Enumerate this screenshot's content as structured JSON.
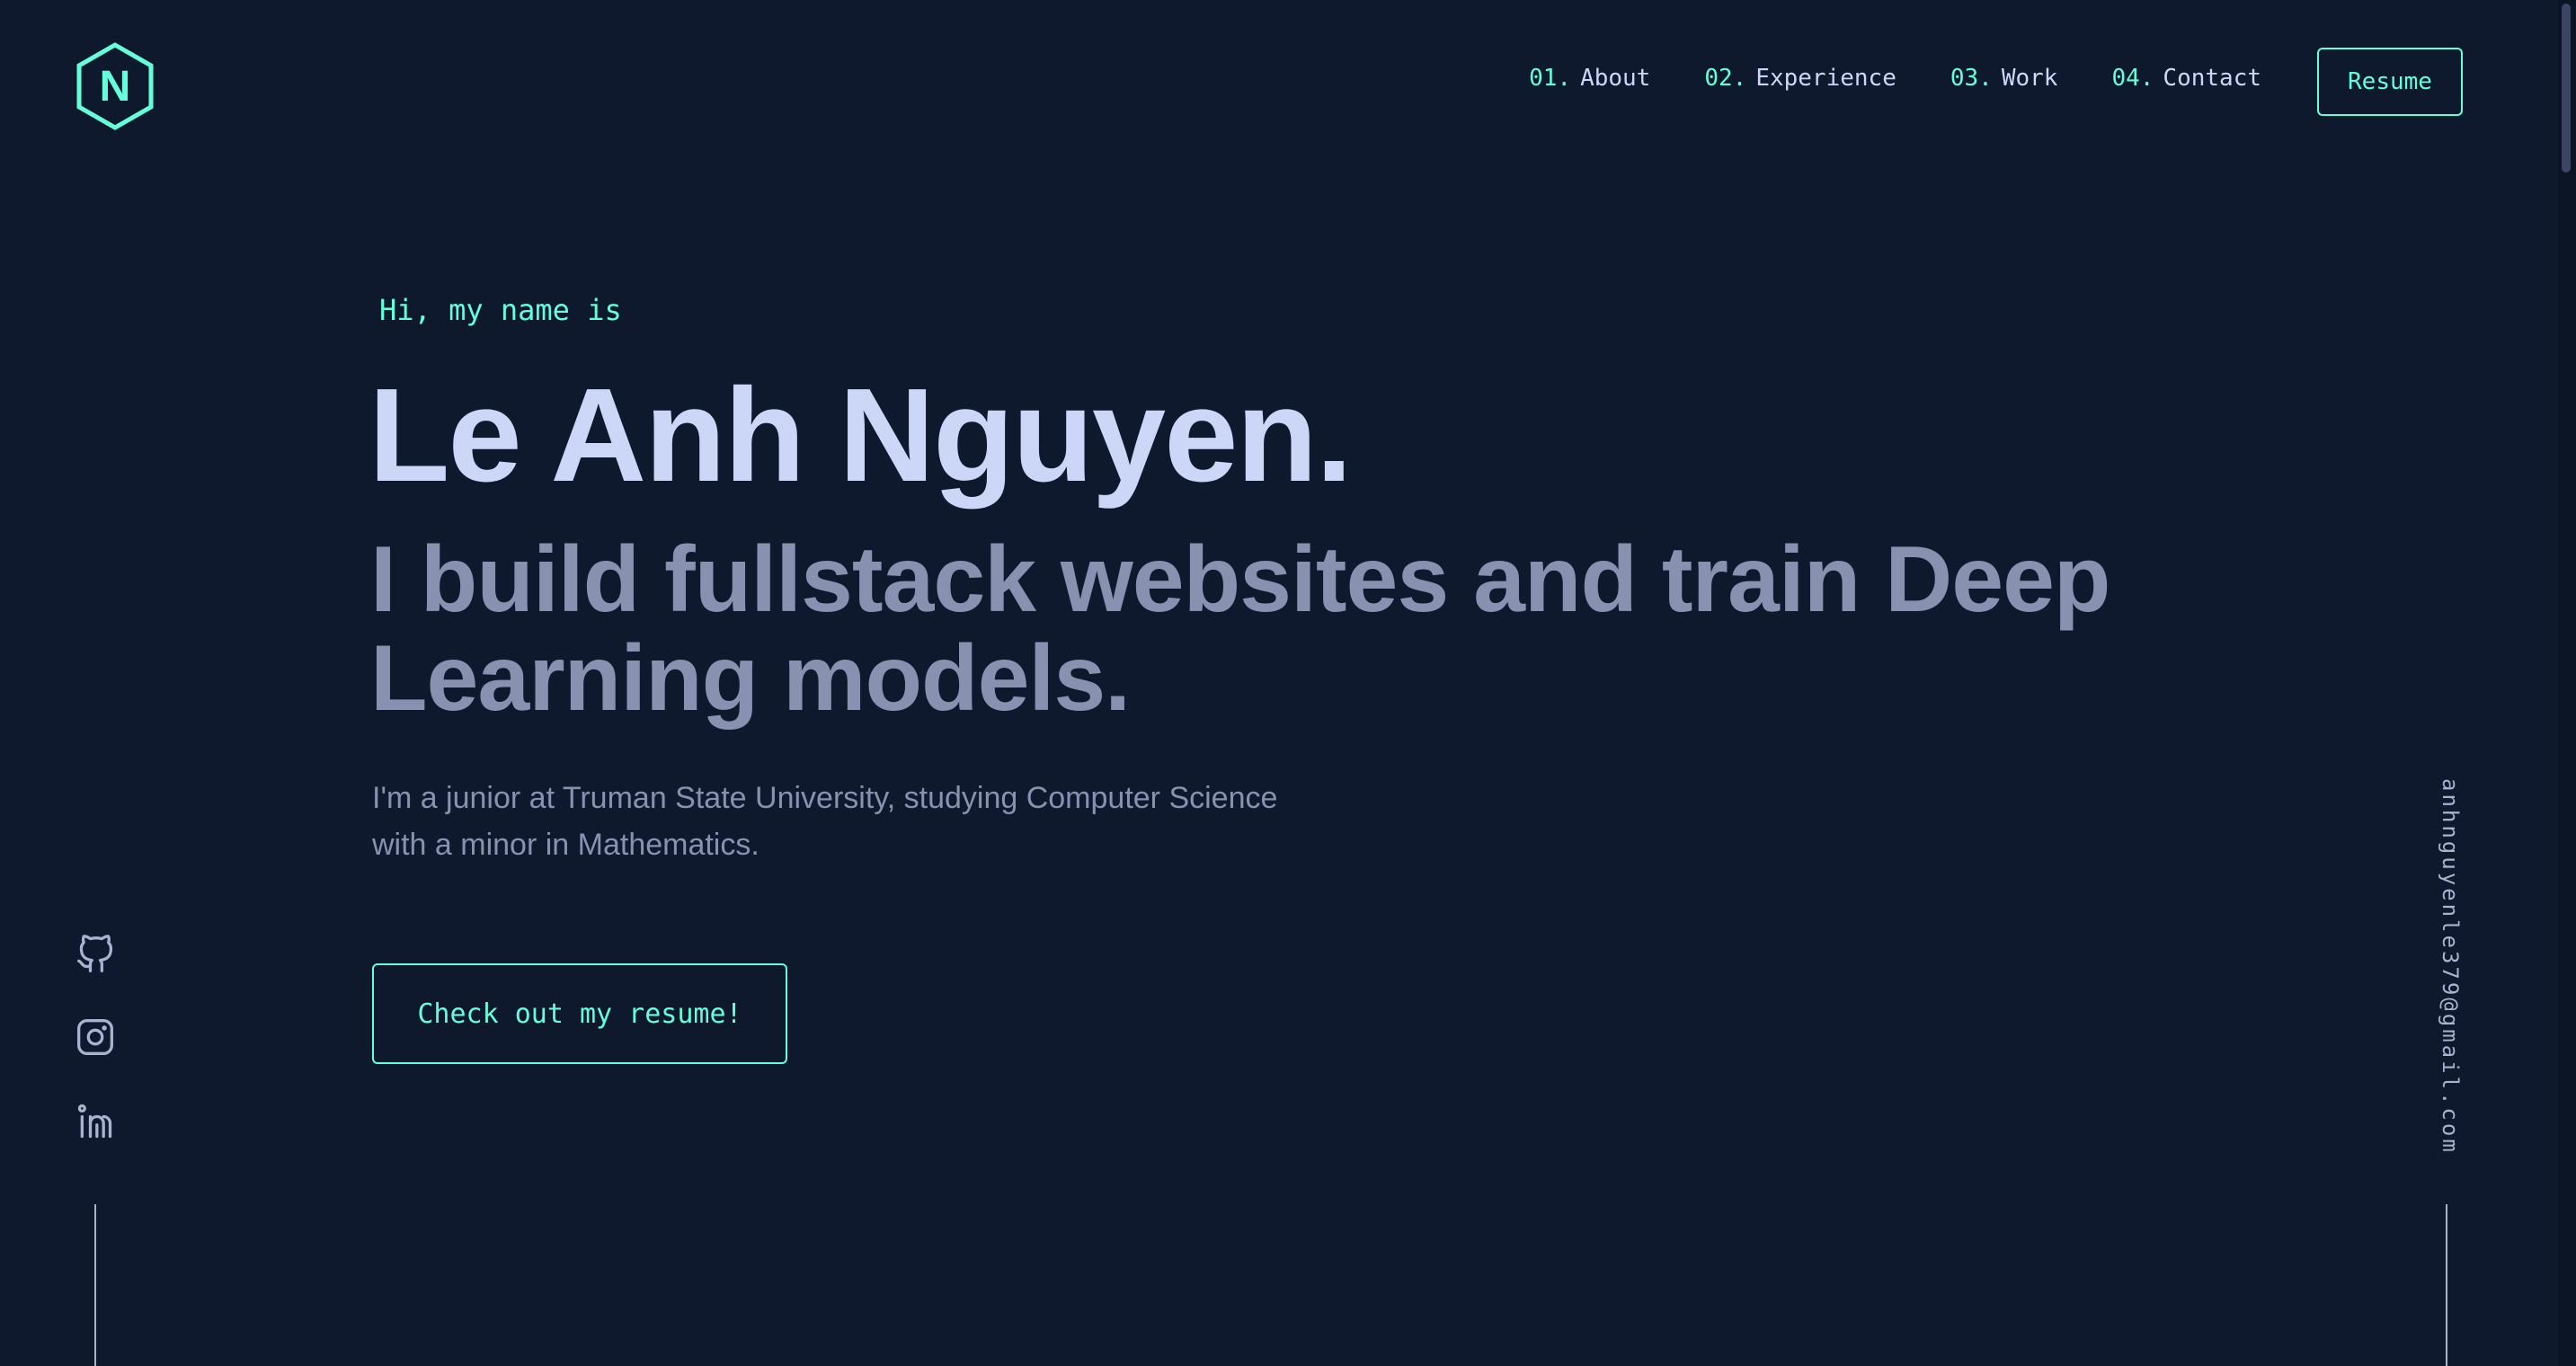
{
  "logo": {
    "letter": "N",
    "icon": "hexagon-logo-icon"
  },
  "nav": {
    "items": [
      {
        "number": "01.",
        "label": "About"
      },
      {
        "number": "02.",
        "label": "Experience"
      },
      {
        "number": "03.",
        "label": "Work"
      },
      {
        "number": "04.",
        "label": "Contact"
      }
    ],
    "resume_label": "Resume"
  },
  "hero": {
    "greeting": "Hi, my name is",
    "name": "Le Anh Nguyen.",
    "tagline_line1": "I build fullstack websites and train Deep",
    "tagline_line2": "Learning models.",
    "bio_line1": "I'm a junior at Truman State University, studying Computer Science",
    "bio_line2": "with a minor in Mathematics.",
    "cta_label": "Check out my resume!"
  },
  "social": {
    "icons": [
      "github-icon",
      "instagram-icon",
      "linkedin-icon"
    ]
  },
  "email": "anhnguyenle379@gmail.com",
  "colors": {
    "background": "#0e192d",
    "accent": "#64ffda",
    "heading": "#ccd6f6",
    "muted": "#8892b0"
  }
}
